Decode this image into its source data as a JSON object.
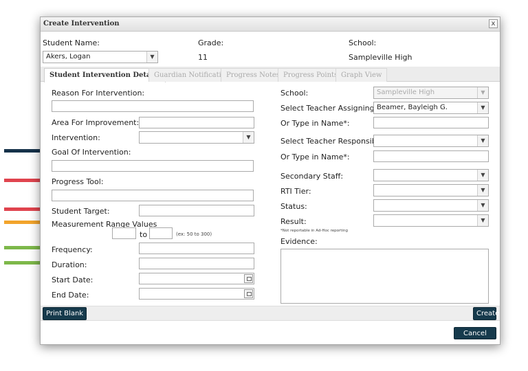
{
  "dialog": {
    "title": "Create Intervention",
    "close_label": "x"
  },
  "header": {
    "student_name_label": "Student Name:",
    "student_name_value": "Akers, Logan",
    "grade_label": "Grade:",
    "grade_value": "11",
    "school_label": "School:",
    "school_value": "Sampleville High"
  },
  "tabs": [
    {
      "label": "Student Intervention Details",
      "active": true
    },
    {
      "label": "Guardian Notifications",
      "active": false
    },
    {
      "label": "Progress Notes",
      "active": false
    },
    {
      "label": "Progress Points",
      "active": false
    },
    {
      "label": "Graph View",
      "active": false
    }
  ],
  "left": {
    "reason_label": "Reason For Intervention:",
    "area_label": "Area For Improvement:",
    "intervention_label": "Intervention:",
    "goal_label": "Goal Of Intervention:",
    "progress_tool_label": "Progress Tool:",
    "student_target_label": "Student Target:",
    "measurement_label": "Measurement Range Values",
    "to_label": "to",
    "range_hint": "(ex: 50 to 300)",
    "frequency_label": "Frequency:",
    "duration_label": "Duration:",
    "start_date_label": "Start Date:",
    "end_date_label": "End Date:"
  },
  "right": {
    "school_label": "School:",
    "school_value": "Sampleville High",
    "teacher_assigning_label": "Select Teacher Assigning:",
    "teacher_assigning_value": "Beamer, Bayleigh G.",
    "type_name_label_1": "Or Type in Name*:",
    "teacher_responsible_label": "Select Teacher Responsible:",
    "type_name_label_2": "Or Type in Name*:",
    "secondary_staff_label": "Secondary Staff:",
    "rti_tier_label": "RTI Tier:",
    "status_label": "Status:",
    "result_label": "Result:",
    "adhoc_note": "*Not reportable in Ad-Hoc reporting",
    "evidence_label": "Evidence:"
  },
  "buttons": {
    "print_blank": "Print Blank",
    "create": "Create",
    "cancel": "Cancel"
  },
  "colors": {
    "arrow_navy": "#16324a",
    "arrow_red": "#e0444e",
    "arrow_orange": "#f2a42c",
    "arrow_green": "#7db84a",
    "button_dark": "#163a4c"
  },
  "icons": {
    "dropdown": "chevron-down-icon",
    "calendar": "calendar-icon",
    "close": "close-icon"
  }
}
